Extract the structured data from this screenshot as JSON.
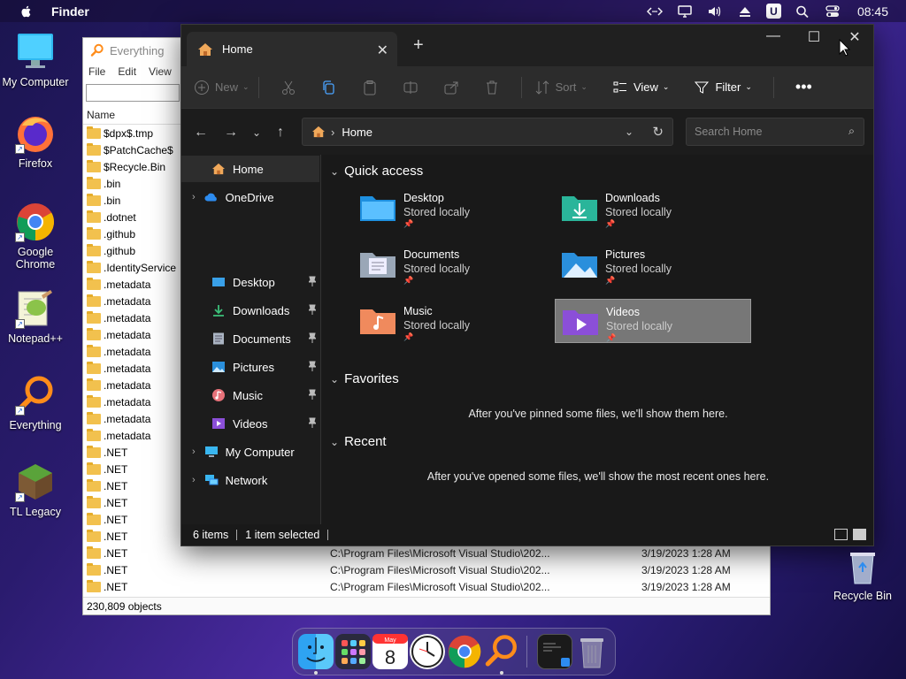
{
  "menubar": {
    "app_name": "Finder",
    "time": "08:45",
    "icons": [
      "apple-icon",
      "remote-icon",
      "display-icon",
      "volume-icon",
      "eject-icon",
      "u-app-icon",
      "search-icon",
      "control-center-icon"
    ]
  },
  "desktop": {
    "icons": [
      {
        "label": "My Computer",
        "icon": "computer-icon"
      },
      {
        "label": "Firefox",
        "icon": "firefox-icon"
      },
      {
        "label": "Google Chrome",
        "icon": "chrome-icon"
      },
      {
        "label": "Notepad++",
        "icon": "notepadpp-icon"
      },
      {
        "label": "Everything",
        "icon": "everything-icon"
      },
      {
        "label": "TL Legacy",
        "icon": "tl-legacy-icon"
      }
    ],
    "recycle_bin": "Recycle Bin"
  },
  "everything": {
    "title": "Everything",
    "menu": [
      "File",
      "Edit",
      "View"
    ],
    "column_name": "Name",
    "rows": [
      {
        "name": "$dpx$.tmp"
      },
      {
        "name": "$PatchCache$"
      },
      {
        "name": "$Recycle.Bin"
      },
      {
        "name": ".bin"
      },
      {
        "name": ".bin"
      },
      {
        "name": ".dotnet"
      },
      {
        "name": ".github"
      },
      {
        "name": ".github"
      },
      {
        "name": ".IdentityService"
      },
      {
        "name": ".metadata"
      },
      {
        "name": ".metadata"
      },
      {
        "name": ".metadata"
      },
      {
        "name": ".metadata"
      },
      {
        "name": ".metadata"
      },
      {
        "name": ".metadata"
      },
      {
        "name": ".metadata"
      },
      {
        "name": ".metadata"
      },
      {
        "name": ".metadata"
      },
      {
        "name": ".metadata"
      },
      {
        "name": ".NET"
      },
      {
        "name": ".NET"
      },
      {
        "name": ".NET"
      },
      {
        "name": ".NET"
      },
      {
        "name": ".NET"
      },
      {
        "name": ".NET"
      },
      {
        "name": ".NET",
        "path": "C:\\Program Files\\Microsoft Visual Studio\\202...",
        "date": "3/19/2023 1:28 AM"
      },
      {
        "name": ".NET",
        "path": "C:\\Program Files\\Microsoft Visual Studio\\202...",
        "date": "3/19/2023 1:28 AM"
      },
      {
        "name": ".NET",
        "path": "C:\\Program Files\\Microsoft Visual Studio\\202...",
        "date": "3/19/2023 1:28 AM"
      }
    ],
    "status": "230,809 objects"
  },
  "explorer": {
    "tab_title": "Home",
    "toolbar": {
      "new_label": "New",
      "sort_label": "Sort",
      "view_label": "View",
      "filter_label": "Filter"
    },
    "address": "Home",
    "search_placeholder": "Search Home",
    "nav": {
      "home": "Home",
      "onedrive": "OneDrive",
      "pinned": [
        "Desktop",
        "Downloads",
        "Documents",
        "Pictures",
        "Music",
        "Videos"
      ],
      "my_computer": "My Computer",
      "network": "Network"
    },
    "sections": {
      "quick_access": "Quick access",
      "favorites": "Favorites",
      "recent": "Recent"
    },
    "quick_access_items": [
      {
        "name": "Desktop",
        "sub": "Stored locally",
        "color": "#1e90e0"
      },
      {
        "name": "Downloads",
        "sub": "Stored locally",
        "color": "#2ab59a"
      },
      {
        "name": "Documents",
        "sub": "Stored locally",
        "color": "#9aa7b7"
      },
      {
        "name": "Pictures",
        "sub": "Stored locally",
        "color": "#2a8fdc"
      },
      {
        "name": "Music",
        "sub": "Stored locally",
        "color": "#f08a5d"
      },
      {
        "name": "Videos",
        "sub": "Stored locally",
        "color": "#8b4fd8"
      }
    ],
    "favorites_message": "After you've pinned some files, we'll show them here.",
    "recent_message": "After you've opened some files, we'll show the most recent ones here.",
    "status": {
      "items": "6 items",
      "selected": "1 item selected"
    }
  }
}
